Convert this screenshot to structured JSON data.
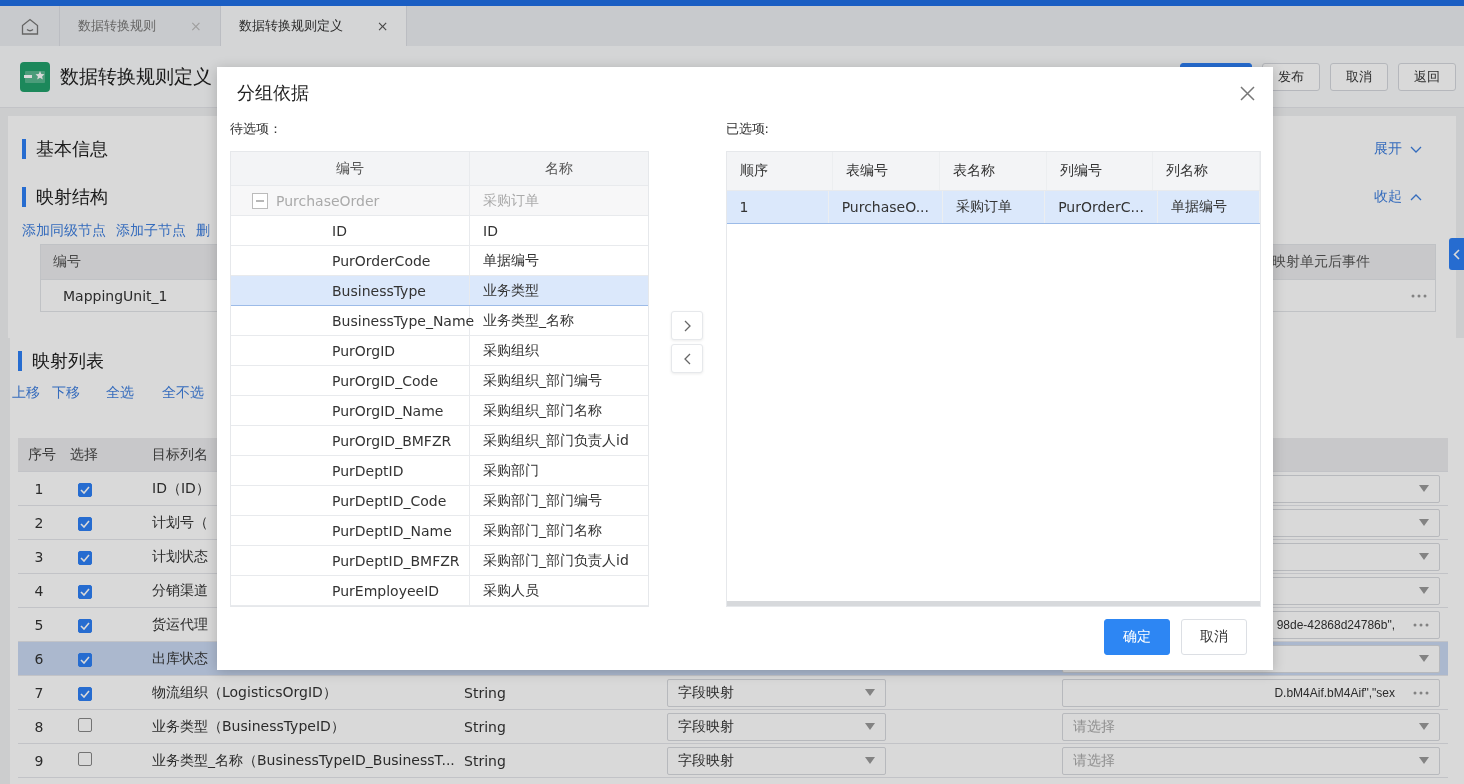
{
  "tabs": [
    {
      "label": "数据转换规则",
      "selected": false,
      "close": "×"
    },
    {
      "label": "数据转换规则定义",
      "selected": true,
      "close": "×"
    }
  ],
  "header": {
    "title": "数据转换规则定义",
    "buttons": [
      {
        "kind": "primary"
      },
      {
        "kind": "default",
        "label": "发布"
      },
      {
        "kind": "default",
        "label": "取消"
      },
      {
        "kind": "default",
        "label": "返回"
      }
    ]
  },
  "basic_info": {
    "title": "基本信息",
    "toggle": "展开",
    "expanded": false
  },
  "mapping_structure": {
    "title": "映射结构",
    "toggle": "收起",
    "expanded": true,
    "actions": [
      "添加同级节点",
      "添加子节点",
      "删"
    ],
    "columns": [
      "编号",
      "映射单元后事件"
    ],
    "rows": [
      {
        "code": "MappingUnit_1"
      }
    ]
  },
  "mapping_list": {
    "title": "映射列表",
    "actions": [
      "上移",
      "下移",
      "全选",
      "全不选"
    ],
    "columns": [
      "序号",
      "选择",
      "目标列名"
    ],
    "rows": [
      {
        "index": "1",
        "checked": true,
        "selected": false,
        "target": "ID（ID）",
        "kind": "select"
      },
      {
        "index": "2",
        "checked": true,
        "selected": false,
        "target": "计划号（",
        "kind": "select"
      },
      {
        "index": "3",
        "checked": true,
        "selected": false,
        "target": "计划状态",
        "kind": "select"
      },
      {
        "index": "4",
        "checked": true,
        "selected": false,
        "target": "分销渠道",
        "kind": "select"
      },
      {
        "index": "5",
        "checked": true,
        "selected": false,
        "target": "货运代理",
        "kind": "text",
        "value": "98de-42868d24786b\","
      },
      {
        "index": "6",
        "checked": true,
        "selected": true,
        "target": "出库状态",
        "kind": "select"
      },
      {
        "index": "7",
        "checked": true,
        "selected": false,
        "target": "物流组织（LogisticsOrgID）",
        "type": "String",
        "mapping": "字段映射",
        "kind": "text",
        "value": "D.bM4Aif.bM4Aif\",\"sex"
      },
      {
        "index": "8",
        "checked": false,
        "selected": false,
        "target": "业务类型（BusinessTypeID）",
        "type": "String",
        "mapping": "字段映射",
        "kind": "select",
        "placeholder": "请选择"
      },
      {
        "index": "9",
        "checked": false,
        "selected": false,
        "target": "业务类型_名称（BusinessTypeID_BusinessT...",
        "type": "String",
        "mapping": "字段映射",
        "kind": "select",
        "placeholder": "请选择"
      }
    ]
  },
  "dialog": {
    "title": "分组依据",
    "available": {
      "label": "待选项：",
      "columns": [
        "编号",
        "名称"
      ],
      "tree": [
        {
          "code": "PurchaseOrder",
          "name": "采购订单",
          "expanded": true,
          "disabled": true,
          "selected": false,
          "children": [
            {
              "code": "ID",
              "name": "ID",
              "selected": false
            },
            {
              "code": "PurOrderCode",
              "name": "单据编号",
              "selected": false
            },
            {
              "code": "BusinessType",
              "name": "业务类型",
              "selected": true
            },
            {
              "code": "BusinessType_Name",
              "name": "业务类型_名称",
              "selected": false
            },
            {
              "code": "PurOrgID",
              "name": "采购组织",
              "selected": false
            },
            {
              "code": "PurOrgID_Code",
              "name": "采购组织_部门编号",
              "selected": false
            },
            {
              "code": "PurOrgID_Name",
              "name": "采购组织_部门名称",
              "selected": false
            },
            {
              "code": "PurOrgID_BMFZR",
              "name": "采购组织_部门负责人id",
              "selected": false
            },
            {
              "code": "PurDeptID",
              "name": "采购部门",
              "selected": false
            },
            {
              "code": "PurDeptID_Code",
              "name": "采购部门_部门编号",
              "selected": false
            },
            {
              "code": "PurDeptID_Name",
              "name": "采购部门_部门名称",
              "selected": false
            },
            {
              "code": "PurDeptID_BMFZR",
              "name": "采购部门_部门负责人id",
              "selected": false
            },
            {
              "code": "PurEmployeeID",
              "name": "采购人员",
              "selected": false
            }
          ]
        }
      ]
    },
    "chosen": {
      "label": "已选项:",
      "columns": [
        "顺序",
        "表编号",
        "表名称",
        "列编号",
        "列名称"
      ],
      "rows": [
        {
          "cells": [
            "1",
            "PurchaseO...",
            "采购订单",
            "PurOrderC...",
            "单据编号"
          ],
          "selected": true
        }
      ]
    },
    "buttons": [
      {
        "kind": "primary",
        "label": "确定"
      },
      {
        "kind": "default",
        "label": "取消"
      }
    ]
  }
}
